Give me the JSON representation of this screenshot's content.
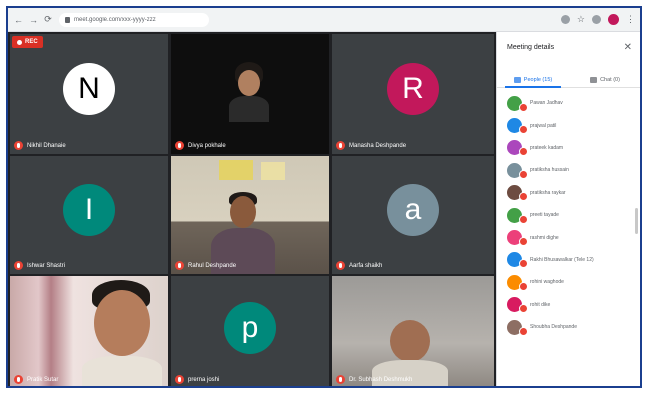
{
  "browser": {
    "url": "meet.google.com/xxx-yyyy-zzz",
    "nav": {
      "back": "←",
      "forward": "→",
      "reload": "⟳"
    }
  },
  "meeting": {
    "recording_badge": "REC",
    "tiles": [
      {
        "name": "Nikhil Dhanaie",
        "avatar_letter": "N",
        "avatar_color": "#ffffff",
        "letter_color": "#000000",
        "kind": "avatar"
      },
      {
        "name": "Divya pokhale",
        "kind": "portrait"
      },
      {
        "name": "Manasha Deshpande",
        "avatar_letter": "R",
        "avatar_color": "#c2185b",
        "letter_color": "#ffffff",
        "kind": "avatar"
      },
      {
        "name": "Ishwar Shastri",
        "avatar_letter": "I",
        "avatar_color": "#00897b",
        "letter_color": "#ffffff",
        "kind": "avatar"
      },
      {
        "name": "Rahul Deshpande",
        "kind": "room"
      },
      {
        "name": "Aarfa shaikh",
        "avatar_letter": "a",
        "avatar_color": "#78909c",
        "letter_color": "#ffffff",
        "kind": "avatar"
      },
      {
        "name": "Pratik Sutar",
        "kind": "window"
      },
      {
        "name": "prerna joshi",
        "avatar_letter": "p",
        "avatar_color": "#00897b",
        "letter_color": "#ffffff",
        "kind": "avatar"
      },
      {
        "name": "Dr. Subhash Deshmukh",
        "kind": "wall"
      }
    ]
  },
  "panel": {
    "title": "Meeting details",
    "close": "✕",
    "tabs": [
      {
        "label": "People (15)",
        "active": true
      },
      {
        "label": "Chat (0)",
        "active": false
      }
    ],
    "people": [
      {
        "name": "Pawan Jadhav",
        "color": "#43a047"
      },
      {
        "name": "prajwal patil",
        "color": "#1e88e5"
      },
      {
        "name": "prateek kadam",
        "color": "#ab47bc"
      },
      {
        "name": "pratiksha hussain",
        "color": "#78909c"
      },
      {
        "name": "pratiksha raykar",
        "color": "#6d4c41"
      },
      {
        "name": "preeti tayade",
        "color": "#43a047"
      },
      {
        "name": "rashmi dighe",
        "color": "#ec407a"
      },
      {
        "name": "Rakhi Bhusawalkar (Tele 12)",
        "color": "#1e88e5"
      },
      {
        "name": "rohini waghode",
        "color": "#fb8c00"
      },
      {
        "name": "rohit dike",
        "color": "#d81b60"
      },
      {
        "name": "Shoubha Deshpande",
        "color": "#8d6e63"
      }
    ]
  }
}
